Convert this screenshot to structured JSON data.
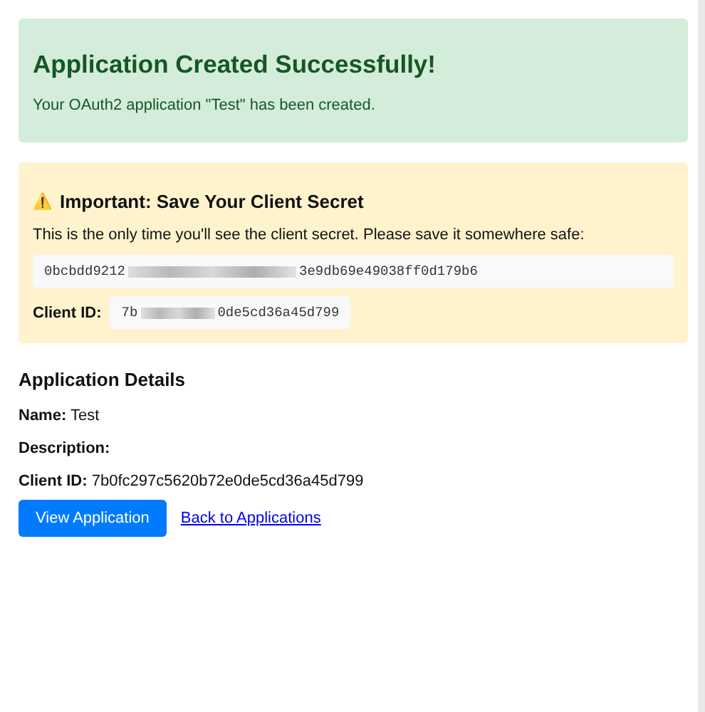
{
  "success": {
    "title": "Application Created Successfully!",
    "message": "Your OAuth2 application \"Test\" has been created."
  },
  "secret_notice": {
    "icon": "⚠️",
    "title": "Important: Save Your Client Secret",
    "message": "This is the only time you'll see the client secret. Please save it somewhere safe:",
    "secret": {
      "start": "0bcbdd9212",
      "end": "3e9db69e49038ff0d179b6"
    },
    "client_id": {
      "label": "Client ID:",
      "start": "7b",
      "end": "0de5cd36a45d799"
    }
  },
  "details": {
    "title": "Application Details",
    "fields": [
      {
        "label": "Name:",
        "value": "Test"
      },
      {
        "label": "Description:"
      },
      {
        "label": "Client ID:",
        "value": "7b0fc297c5620b72e0de5cd36a45d799"
      }
    ]
  },
  "actions": {
    "primary": "View Application",
    "link": "Back to Applications"
  }
}
